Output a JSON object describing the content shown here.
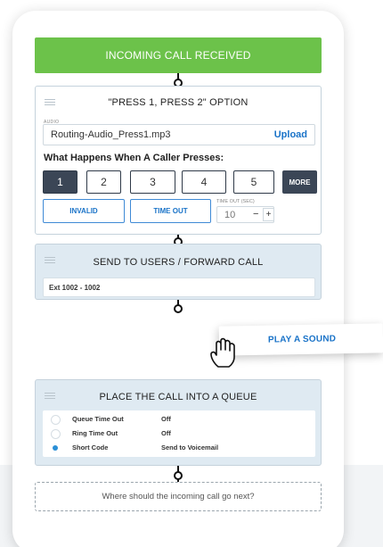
{
  "trigger": {
    "label": "INCOMING CALL RECEIVED"
  },
  "press_option": {
    "title": "\"PRESS 1, PRESS 2\" OPTION",
    "audio_caption": "AUDIO",
    "audio_file": "Routing-Audio_Press1.mp3",
    "upload_label": "Upload",
    "question": "What Happens When A Caller Presses:",
    "keys": [
      "1",
      "2",
      "3",
      "4",
      "5"
    ],
    "selected_key": "1",
    "more_label": "MORE",
    "invalid_label": "INVALID",
    "timeout_label": "TIME OUT",
    "timeout_caption": "TIME OUT (SEC)",
    "timeout_value": "10",
    "minus_label": "−",
    "plus_label": "+"
  },
  "send_users": {
    "title": "SEND TO USERS / FORWARD CALL",
    "extension": "Ext 1002 - 1002"
  },
  "drag_item": {
    "label": "PLAY A SOUND"
  },
  "queue": {
    "title": "PLACE THE CALL INTO A QUEUE",
    "rows": [
      {
        "label": "Queue Time Out",
        "value": "Off",
        "selected": false
      },
      {
        "label": "Ring Time Out",
        "value": "Off",
        "selected": false
      },
      {
        "label": "Short Code",
        "value": "Send to Voicemail",
        "selected": true
      }
    ]
  },
  "next_step": {
    "placeholder": "Where should the incoming call go next?"
  },
  "colors": {
    "trigger_green": "#6cc24a",
    "accent_blue": "#1a73c8",
    "dark_key": "#3b4656",
    "card_blue": "#dfeaf2"
  }
}
